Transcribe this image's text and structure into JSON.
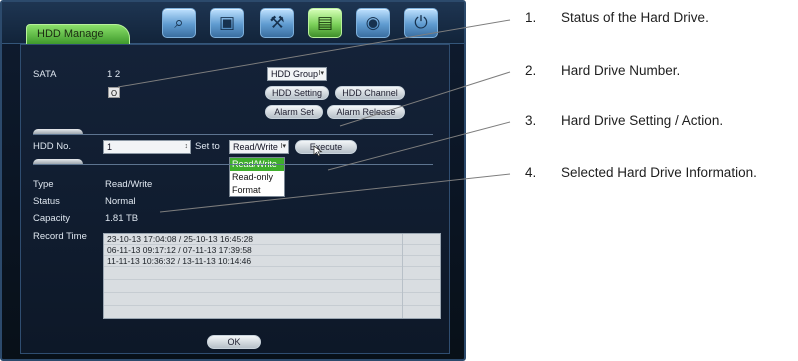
{
  "window": {
    "title": "HDD Manage",
    "toolbar": [
      {
        "icon": "search-icon",
        "glyph": "⌕"
      },
      {
        "icon": "playback-icon",
        "glyph": "▣"
      },
      {
        "icon": "tools-icon",
        "glyph": "⚒"
      },
      {
        "icon": "storage-icon",
        "glyph": "▤"
      },
      {
        "icon": "camera-icon",
        "glyph": "◉"
      },
      {
        "icon": "power-icon",
        "glyph": "⏻"
      }
    ]
  },
  "sata": {
    "label": "SATA",
    "ports": "1   2",
    "disk_status": "O"
  },
  "buttons": {
    "hdd_group": "HDD Group",
    "hdd_setting": "HDD Setting",
    "hdd_channel": "HDD Channel",
    "alarm_set": "Alarm Set",
    "alarm_release": "Alarm Release",
    "execute": "Execute",
    "ok": "OK"
  },
  "hdd": {
    "no_label": "HDD No.",
    "no_value": "1",
    "set_to_label": "Set to",
    "set_to_value": "Read/Write",
    "options": [
      "Read/Write",
      "Read-only",
      "Format"
    ]
  },
  "info": {
    "type_label": "Type",
    "type_value": "Read/Write",
    "status_label": "Status",
    "status_value": "Normal",
    "capacity_label": "Capacity",
    "capacity_value": "1.81 TB",
    "record_time_label": "Record Time",
    "records": [
      "23-10-13 17:04:08 / 25-10-13 16:45:28",
      "06-11-13 09:17:12 / 07-11-13 17:39:58",
      "11-11-13 10:36:32 / 13-11-13 10:14:46"
    ]
  },
  "callouts": [
    {
      "num": "1.",
      "text": "Status of the Hard Drive."
    },
    {
      "num": "2.",
      "text": "Hard Drive Number."
    },
    {
      "num": "3.",
      "text": "Hard Drive Setting / Action."
    },
    {
      "num": "4.",
      "text": "Selected Hard Drive Information."
    }
  ],
  "colors": {
    "active_tab": "#3fae2c",
    "leader_line": "#7d7d7d"
  }
}
